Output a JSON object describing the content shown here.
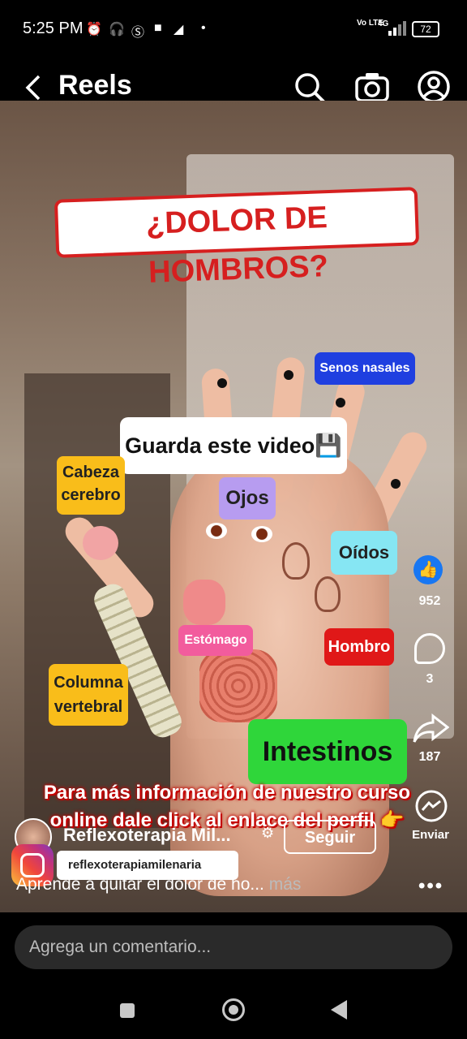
{
  "status_bar": {
    "time": "5:25 PM",
    "network_top": "Vo LTE",
    "network_gen": "4G",
    "battery": "72"
  },
  "header": {
    "title": "Reels",
    "icons": [
      "back-arrow-icon",
      "search-icon",
      "camera-icon",
      "profile-icon"
    ]
  },
  "video": {
    "headline": "¿DOLOR DE HOMBROS?",
    "tags": {
      "senos": "Senos nasales",
      "guarda": "Guarda este video💾",
      "cabeza": "Cabeza cerebro",
      "ojos": "Ojos",
      "oidos": "Oídos",
      "estomago": "Estómago",
      "hombro": "Hombro",
      "columna": "Columna vertebral",
      "intestinos": "Intestinos"
    },
    "promo": "Para más información de nuestro curso online dale click al enlace del perfil 👉",
    "ig_handle": "reflexoterapiamilenaria"
  },
  "actions": {
    "likes": "952",
    "comments": "3",
    "shares": "187",
    "send_label": "Enviar"
  },
  "author": {
    "name": "Reflexoterapia Mil...",
    "follow_label": "Seguir"
  },
  "caption": {
    "text": "Aprende a quitar el dolor de ho...",
    "more": "más"
  },
  "comment": {
    "placeholder": "Agrega un comentario..."
  },
  "colors": {
    "like_blue": "#1877f2",
    "headline_red": "#d61f1f"
  }
}
